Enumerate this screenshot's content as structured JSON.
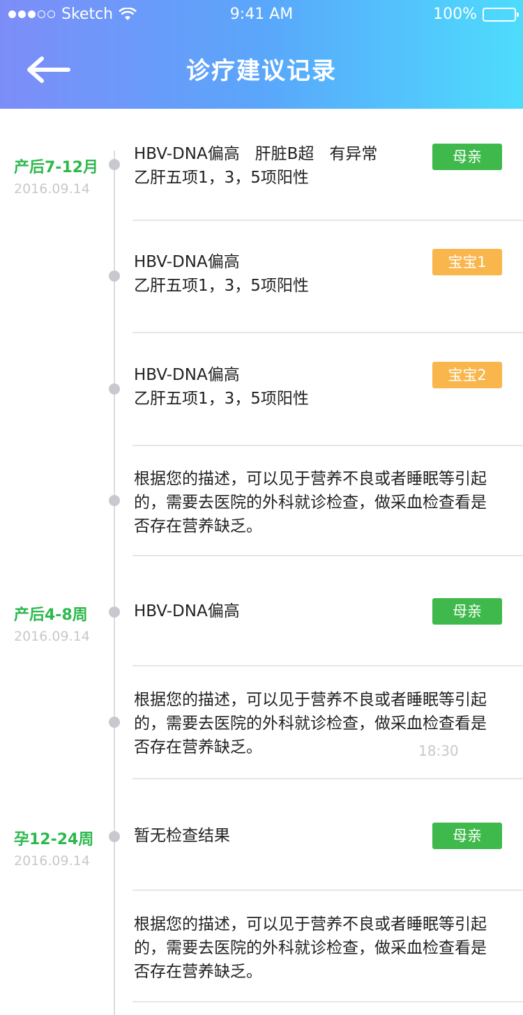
{
  "status_bar": {
    "carrier": "Sketch",
    "time": "9:41 AM",
    "battery": "100%"
  },
  "nav": {
    "title": "诊疗建议记录",
    "back_icon": "arrow-left-icon"
  },
  "colors": {
    "mother_tag": "#3fb94b",
    "baby_tag": "#f8b64c",
    "period_text": "#2db84d"
  },
  "records": [
    {
      "period": "产后7-12月",
      "date": "2016.09.14",
      "lines": [
        "HBV-DNA偏高   肝脏B超   有异常",
        "乙肝五项1，3，5项阳性"
      ],
      "tag": "母亲",
      "tag_type": "mother"
    },
    {
      "lines": [
        "HBV-DNA偏高",
        "乙肝五项1，3，5项阳性"
      ],
      "tag": "宝宝1",
      "tag_type": "baby"
    },
    {
      "lines": [
        "HBV-DNA偏高",
        "乙肝五项1，3，5项阳性"
      ],
      "tag": "宝宝2",
      "tag_type": "baby"
    },
    {
      "lines": [
        "根据您的描述，可以见于营养不良或者睡眠等引起",
        "的，需要去医院的外科就诊检查，做采血检查看是",
        "否存在营养缺乏。"
      ]
    },
    {
      "period": "产后4-8周",
      "date": "2016.09.14",
      "lines": [
        "HBV-DNA偏高"
      ],
      "tag": "母亲",
      "tag_type": "mother"
    },
    {
      "lines": [
        "根据您的描述，可以见于营养不良或者睡眠等引起",
        "的，需要去医院的外科就诊检查，做采血检查看是",
        "否存在营养缺乏。"
      ],
      "timestamp": "18:30"
    },
    {
      "period": "孕12-24周",
      "date": "2016.09.14",
      "lines": [
        "暂无检查结果"
      ],
      "tag": "母亲",
      "tag_type": "mother"
    },
    {
      "lines": [
        "根据您的描述，可以见于营养不良或者睡眠等引起",
        "的，需要去医院的外科就诊检查，做采血检查看是",
        "否存在营养缺乏。"
      ]
    }
  ]
}
